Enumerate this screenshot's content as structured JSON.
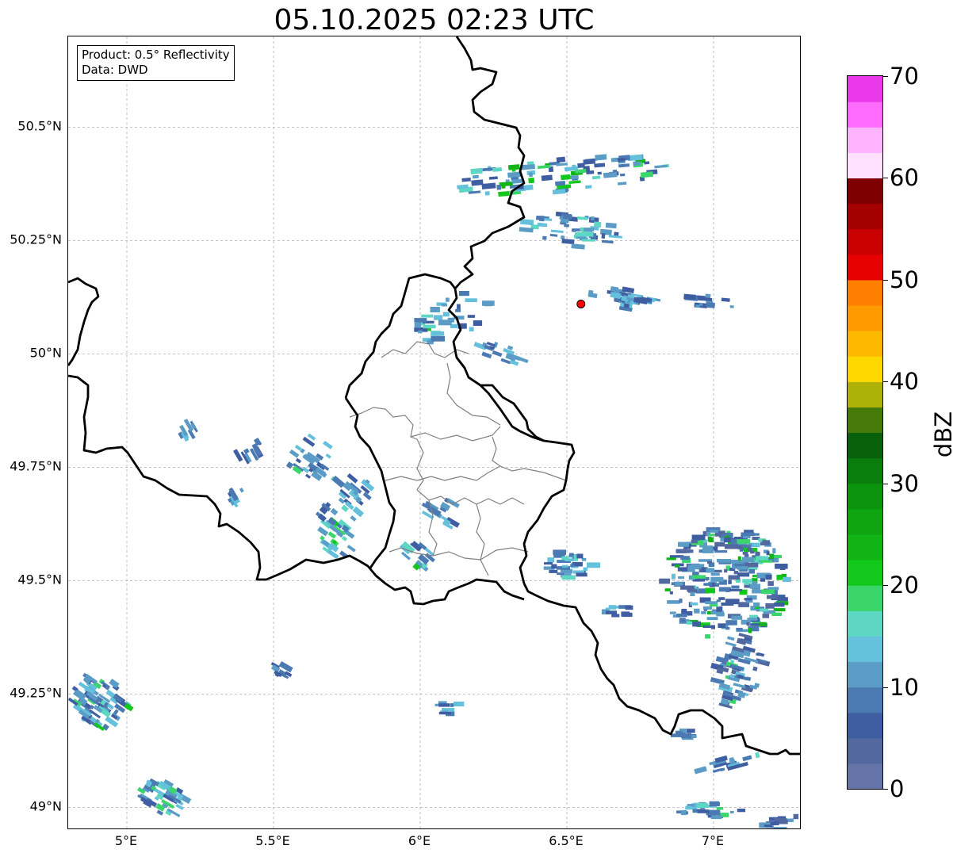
{
  "title": "05.10.2025 02:23 UTC",
  "info": {
    "product": "Product: 0.5° Reflectivity",
    "data": "Data: DWD"
  },
  "map": {
    "lon_range": [
      4.8,
      7.3
    ],
    "lat_range": [
      48.95,
      50.7
    ],
    "lat_ticks": [
      {
        "value": 50.5,
        "label": "50.5°N"
      },
      {
        "value": 50.25,
        "label": "50.25°N"
      },
      {
        "value": 50.0,
        "label": "50°N"
      },
      {
        "value": 49.75,
        "label": "49.75°N"
      },
      {
        "value": 49.5,
        "label": "49.5°N"
      },
      {
        "value": 49.25,
        "label": "49.25°N"
      },
      {
        "value": 49.0,
        "label": "49°N"
      }
    ],
    "lon_ticks": [
      {
        "value": 5.0,
        "label": "5°E"
      },
      {
        "value": 5.5,
        "label": "5.5°E"
      },
      {
        "value": 6.0,
        "label": "6°E"
      },
      {
        "value": 6.5,
        "label": "6.5°E"
      },
      {
        "value": 7.0,
        "label": "7°E"
      }
    ],
    "radar_site": {
      "lon": 6.548,
      "lat": 50.11,
      "color": "#ff0000"
    }
  },
  "colorbar": {
    "label": "dBZ",
    "min": 0,
    "max": 70,
    "ticks": [
      "0",
      "10",
      "20",
      "30",
      "40",
      "50",
      "60",
      "70"
    ],
    "tick_values": [
      0,
      10,
      20,
      30,
      40,
      50,
      60,
      70
    ],
    "colors": [
      "#6474a8",
      "#52689e",
      "#3f5ea2",
      "#4b7ab3",
      "#5a9cc6",
      "#64c0db",
      "#5ed6c4",
      "#3bd66b",
      "#12c81a",
      "#10b515",
      "#0ea510",
      "#0d940e",
      "#0b7d0c",
      "#08600a",
      "#457a0a",
      "#adb108",
      "#ffd800",
      "#ffb800",
      "#ff9a00",
      "#ff7f00",
      "#e60000",
      "#c80000",
      "#a50000",
      "#7e0000",
      "#ffe0ff",
      "#ffb3ff",
      "#ff6bff",
      "#e838e8"
    ]
  }
}
